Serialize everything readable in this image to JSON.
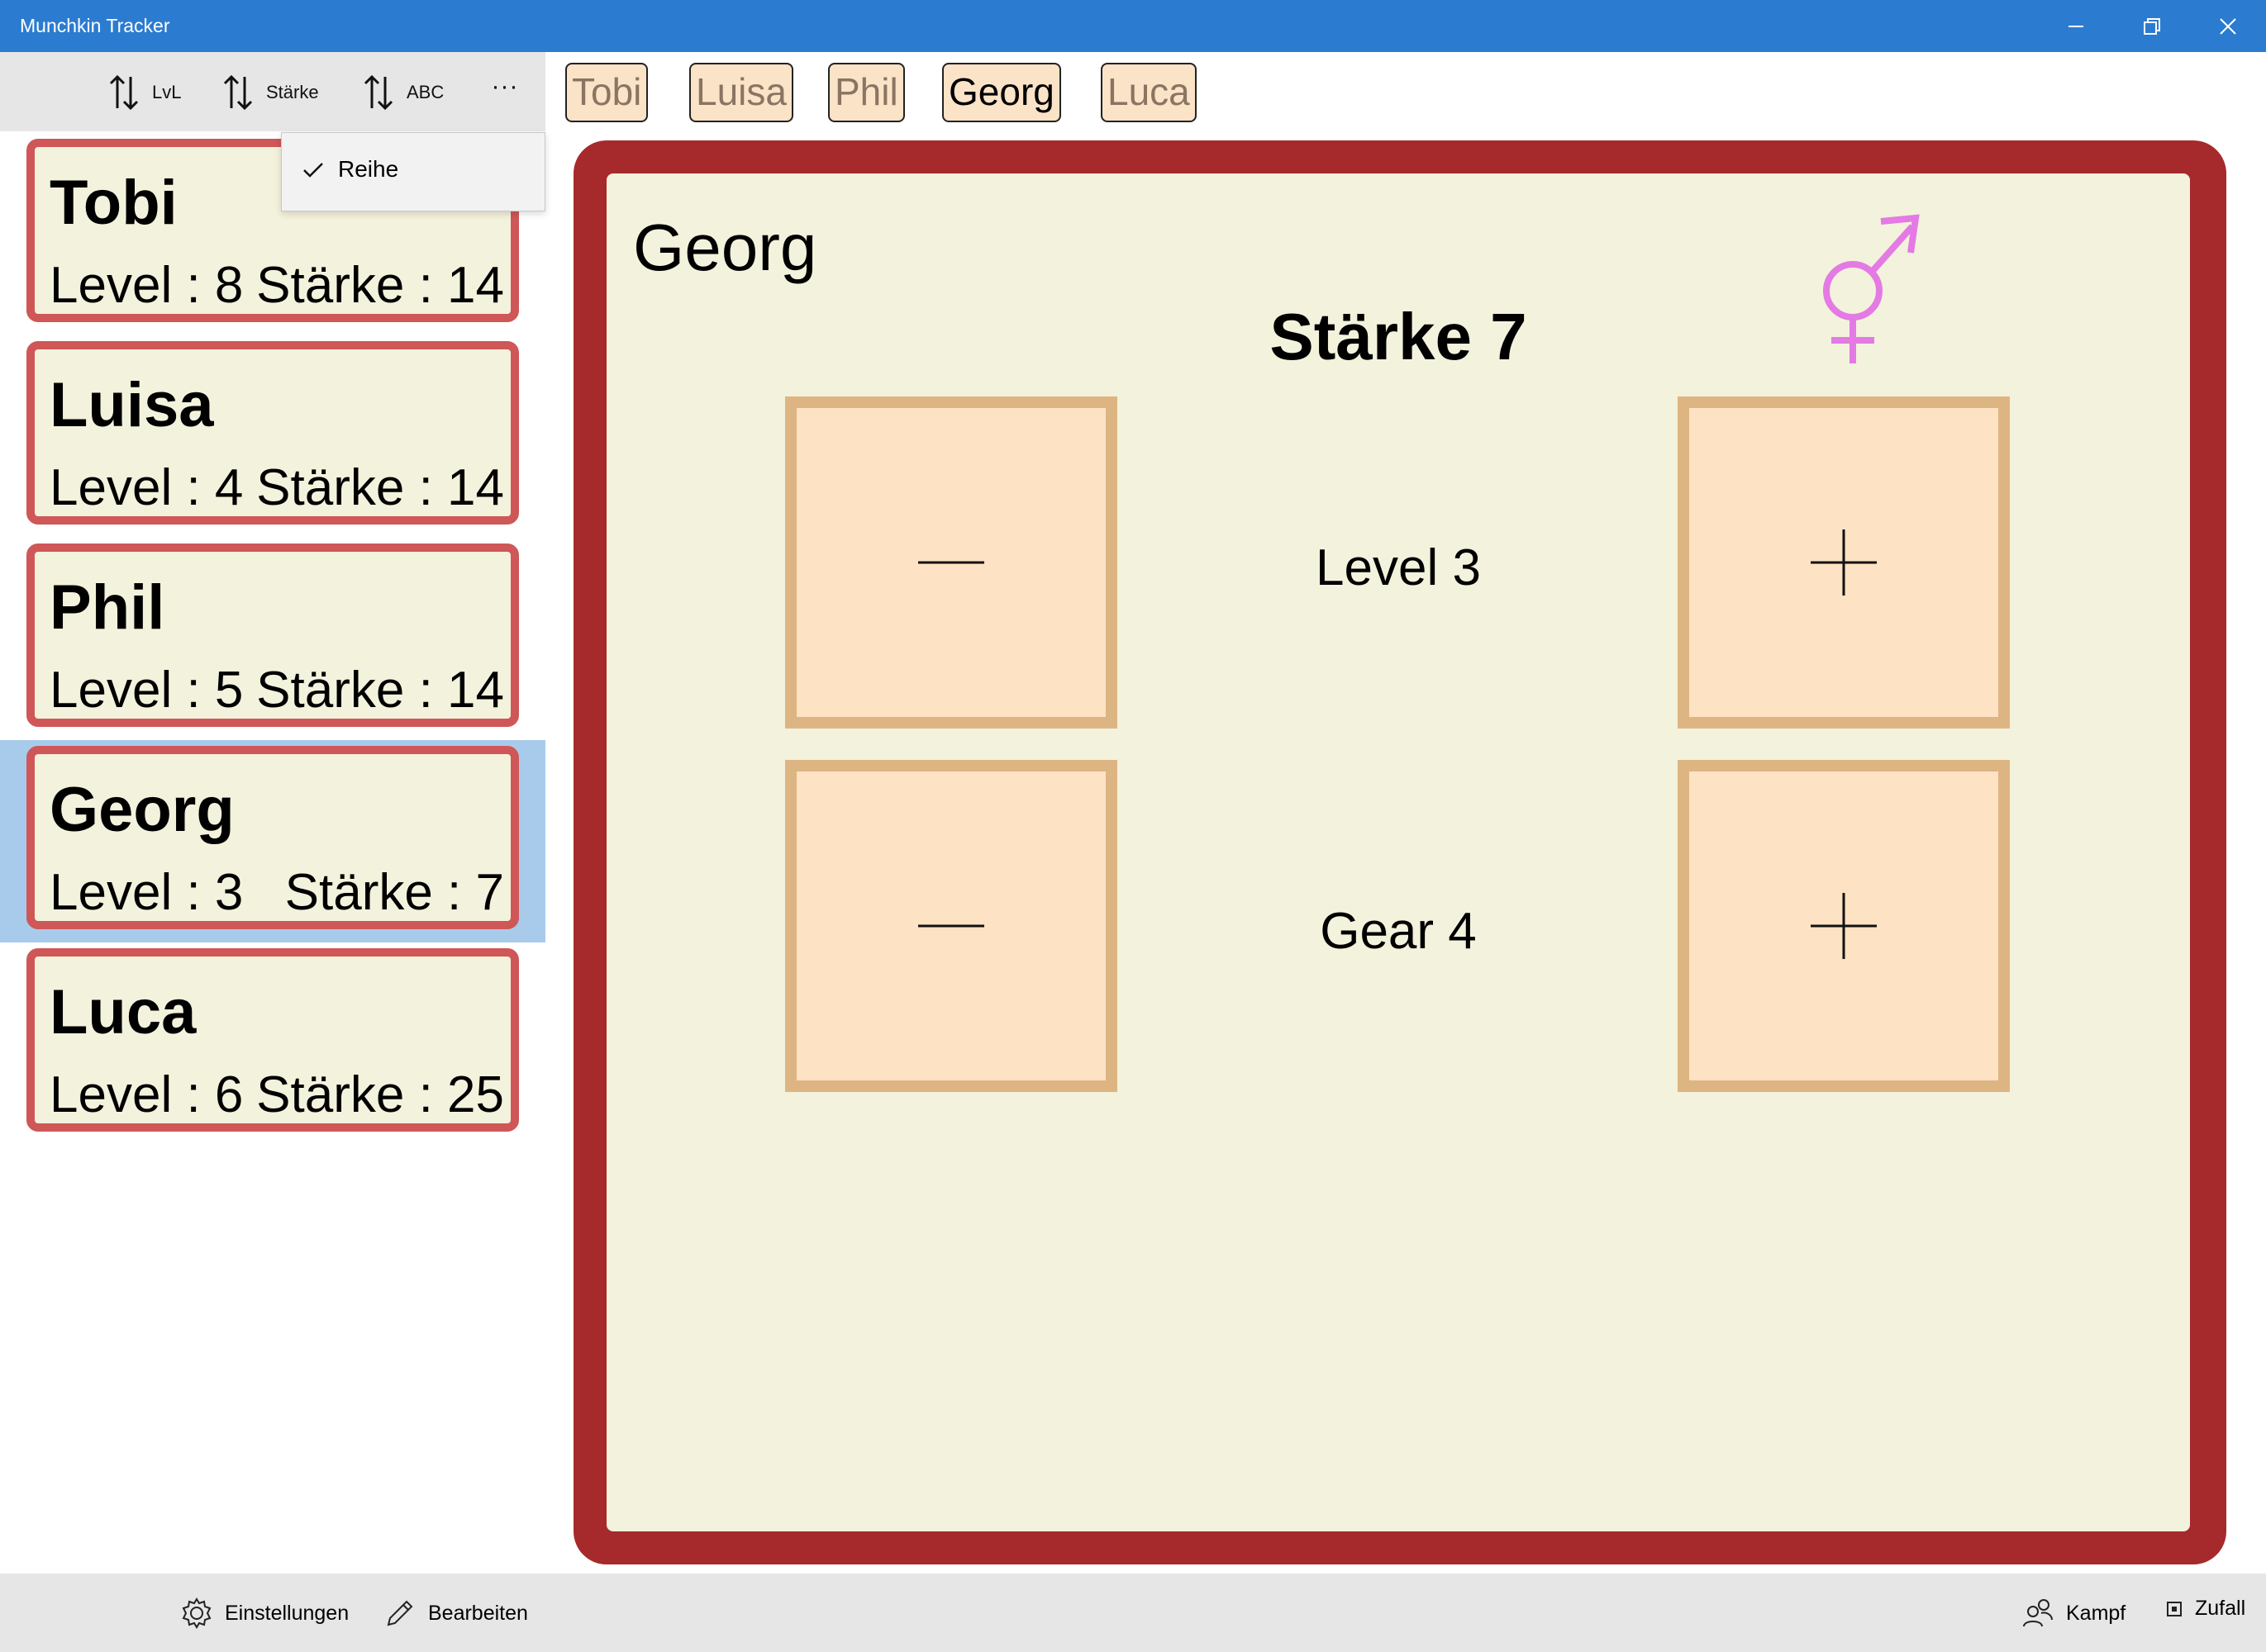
{
  "window": {
    "title": "Munchkin Tracker"
  },
  "sort_bar": {
    "buttons": [
      {
        "label": "LvL",
        "icon": "sort-icon"
      },
      {
        "label": "Stärke",
        "icon": "sort-icon"
      },
      {
        "label": "ABC",
        "icon": "sort-icon"
      }
    ],
    "more_label": "···"
  },
  "dropdown": {
    "items": [
      {
        "label": "Reihe",
        "checked": true
      }
    ]
  },
  "players": [
    {
      "name": "Tobi",
      "level": "Level : 8",
      "strength": "Stärke : 14"
    },
    {
      "name": "Luisa",
      "level": "Level : 4",
      "strength": "Stärke : 14"
    },
    {
      "name": "Phil",
      "level": "Level : 5",
      "strength": "Stärke : 14"
    },
    {
      "name": "Georg",
      "level": "Level : 3",
      "strength": "Stärke : 7"
    },
    {
      "name": "Luca",
      "level": "Level : 6",
      "strength": "Stärke : 25"
    }
  ],
  "selected_player_index": 3,
  "tabs": [
    "Tobi",
    "Luisa",
    "Phil",
    "Georg",
    "Luca"
  ],
  "detail": {
    "name": "Georg",
    "strength": "Stärke 7",
    "gender_icon": "transgender-symbol-icon",
    "level_label": "Level 3",
    "gear_label": "Gear 4"
  },
  "command_bar": {
    "settings": "Einstellungen",
    "edit": "Bearbeiten",
    "fight": "Kampf",
    "random": "Zufall"
  },
  "colors": {
    "titlebar": "#2b7cd0",
    "card_border": "#cf5757",
    "card_bg": "#f3f2dc",
    "board_border": "#a6292c",
    "button_bg": "#fde2c4",
    "button_border": "#ddb583",
    "selection": "#a8cbec",
    "gender_icon": "#e47ae4"
  }
}
